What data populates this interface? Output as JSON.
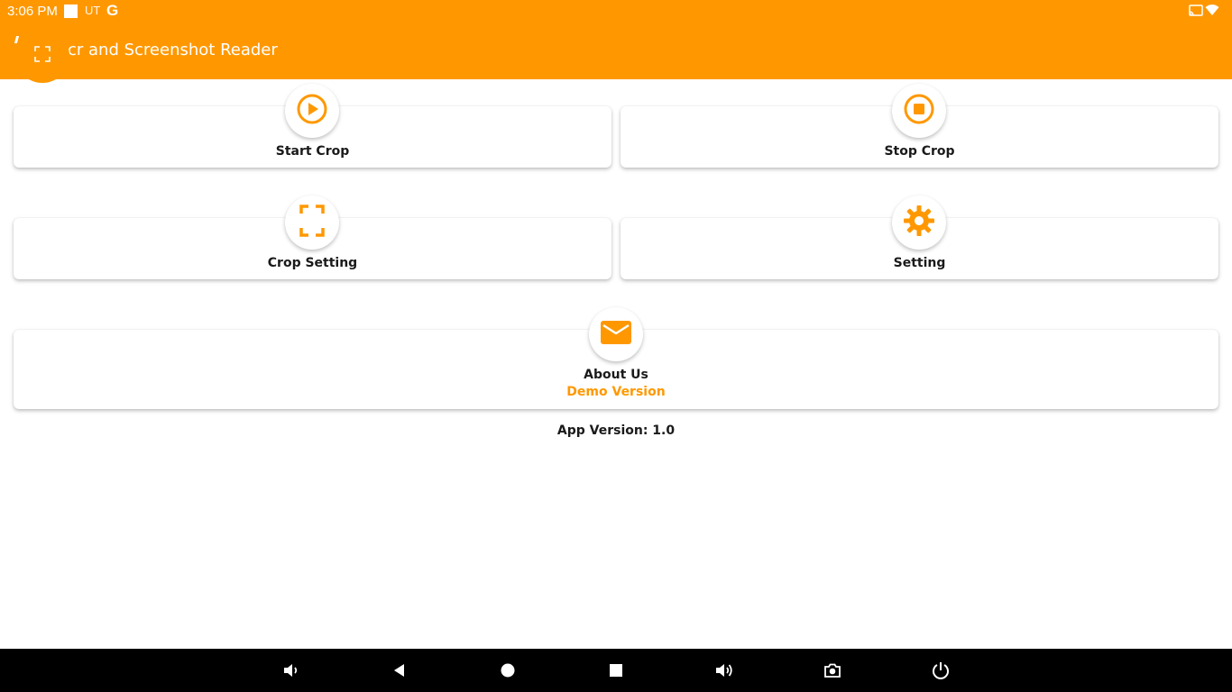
{
  "status_bar": {
    "time": "3:06 PM",
    "carrier": "UT",
    "google": "G",
    "icons": [
      "notification-square-icon",
      "cast-icon",
      "wifi-icon"
    ]
  },
  "app_bar": {
    "title": "cr and Screenshot Reader",
    "fab_icon": "crop-frame-icon"
  },
  "cards": {
    "start_crop": {
      "label": "Start Crop",
      "icon": "play-circle-icon"
    },
    "stop_crop": {
      "label": "Stop Crop",
      "icon": "stop-circle-icon"
    },
    "crop_setting": {
      "label": "Crop Setting",
      "icon": "crop-frame-icon"
    },
    "setting": {
      "label": "Setting",
      "icon": "gear-icon"
    },
    "about_us": {
      "label": "About Us",
      "sub": "Demo Version",
      "icon": "mail-icon"
    }
  },
  "app_version": "App Version: 1.0",
  "nav_bar": {
    "buttons": [
      "volume-down-icon",
      "back-icon",
      "home-icon",
      "recents-icon",
      "volume-up-icon",
      "camera-icon",
      "power-icon"
    ]
  },
  "colors": {
    "accent": "#ff9800",
    "nav_background": "#000000",
    "text": "#1a1a1a"
  }
}
